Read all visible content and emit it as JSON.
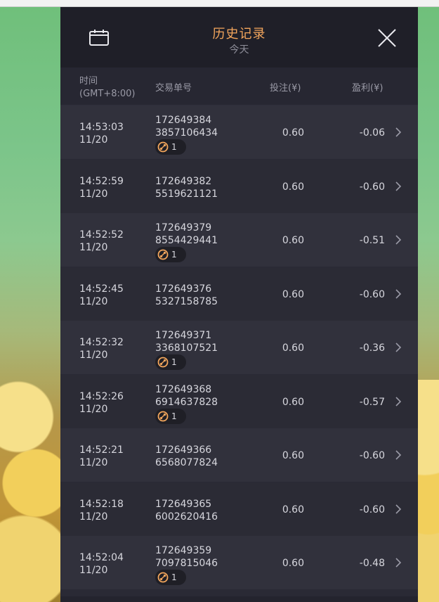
{
  "header": {
    "title": "历史记录",
    "subtitle": "今天",
    "calendar_icon": "calendar-icon",
    "close_icon": "close-icon"
  },
  "columns": {
    "time_label": "时间",
    "timezone": "(GMT+8:00)",
    "order_label": "交易单号",
    "bet_label": "投注(¥)",
    "profit_label": "盈利(¥)"
  },
  "rows": [
    {
      "time": "14:53:03",
      "date": "11/20",
      "order_line1": "172649384",
      "order_line2": "3857106434",
      "bet": "0.60",
      "profit": "-0.06",
      "badge_count": "1"
    },
    {
      "time": "14:52:59",
      "date": "11/20",
      "order_line1": "172649382",
      "order_line2": "5519621121",
      "bet": "0.60",
      "profit": "-0.60",
      "badge_count": ""
    },
    {
      "time": "14:52:52",
      "date": "11/20",
      "order_line1": "172649379",
      "order_line2": "8554429441",
      "bet": "0.60",
      "profit": "-0.51",
      "badge_count": "1"
    },
    {
      "time": "14:52:45",
      "date": "11/20",
      "order_line1": "172649376",
      "order_line2": "5327158785",
      "bet": "0.60",
      "profit": "-0.60",
      "badge_count": ""
    },
    {
      "time": "14:52:32",
      "date": "11/20",
      "order_line1": "172649371",
      "order_line2": "3368107521",
      "bet": "0.60",
      "profit": "-0.36",
      "badge_count": "1"
    },
    {
      "time": "14:52:26",
      "date": "11/20",
      "order_line1": "172649368",
      "order_line2": "6914637828",
      "bet": "0.60",
      "profit": "-0.57",
      "badge_count": "1"
    },
    {
      "time": "14:52:21",
      "date": "11/20",
      "order_line1": "172649366",
      "order_line2": "6568077824",
      "bet": "0.60",
      "profit": "-0.60",
      "badge_count": ""
    },
    {
      "time": "14:52:18",
      "date": "11/20",
      "order_line1": "172649365",
      "order_line2": "6002620416",
      "bet": "0.60",
      "profit": "-0.60",
      "badge_count": ""
    },
    {
      "time": "14:52:04",
      "date": "11/20",
      "order_line1": "172649359",
      "order_line2": "7097815046",
      "bet": "0.60",
      "profit": "-0.48",
      "badge_count": "1"
    }
  ],
  "colors": {
    "accent": "#f3a65c",
    "panel_bg": "#2a2a35"
  }
}
